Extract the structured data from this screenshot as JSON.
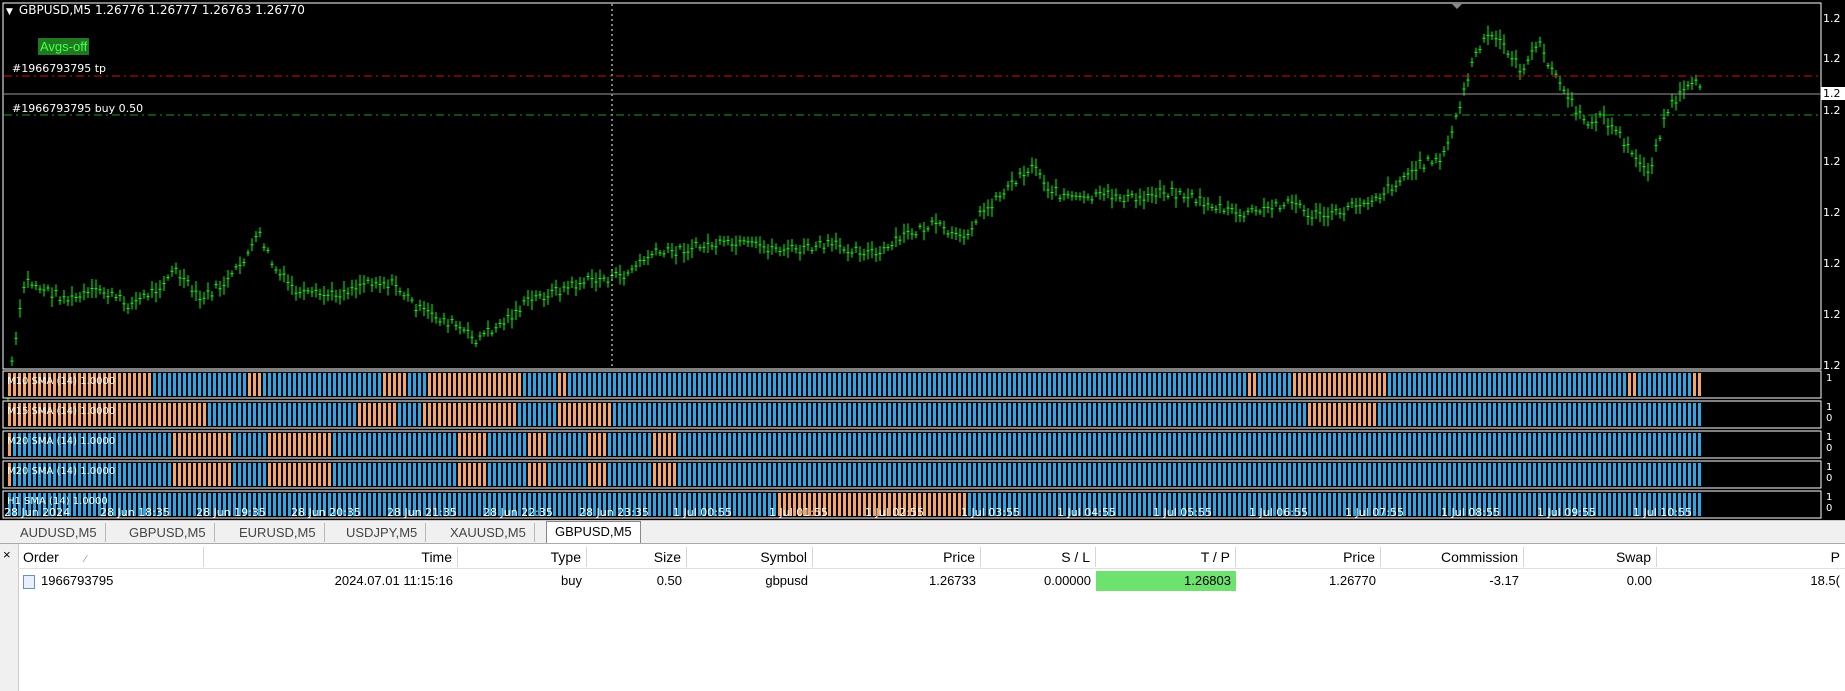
{
  "chart": {
    "symbol_header": "GBPUSD,M5  1.26776 1.26777 1.26763 1.26770",
    "avgs_button": "Avgs-off",
    "tp_label": "#1966793795 tp",
    "buy_label": "#1966793795 buy 0.50",
    "right_price_labels": [
      "1.2",
      "1.2",
      "1.2",
      "1.2",
      "1.2",
      "1.2",
      "1.2",
      "1.2",
      "1.2",
      "1.2",
      "1.2",
      "1.2"
    ],
    "current_price_label": "1.2",
    "colors": {
      "background": "#000000",
      "candle": "#00ff00",
      "tp_line": "#ff0000",
      "buy_line": "#00a000",
      "ind_up": "#2aa7e6",
      "ind_down": "#f5a462"
    },
    "time_ticks": [
      "28 Jun 2024",
      "28 Jun 18:35",
      "28 Jun 19:35",
      "28 Jun 20:35",
      "28 Jun 21:35",
      "28 Jun 22:35",
      "28 Jun 23:35",
      "1 Jul 00:55",
      "1 Jul 01:55",
      "1 Jul 02:55",
      "1 Jul 03:55",
      "1 Jul 04:55",
      "1 Jul 05:55",
      "1 Jul 06:55",
      "1 Jul 07:55",
      "1 Jul 08:55",
      "1 Jul 09:55",
      "1 Jul 10:55"
    ]
  },
  "indicators": [
    {
      "label": "M10 SMA (14) 1.0000",
      "max": "1",
      "min": ""
    },
    {
      "label": "M15 SMA (14) 1.0000",
      "max": "1",
      "min": "0"
    },
    {
      "label": "M20 SMA (14) 1.0000",
      "max": "1",
      "min": "0"
    },
    {
      "label": "M20 SMA (14) 1.0000",
      "max": "1",
      "min": "0"
    },
    {
      "label": "H1 SMA (14) 1.0000",
      "max": "1",
      "min": "0"
    }
  ],
  "tabs": [
    "AUDUSD,M5",
    "GBPUSD,M5",
    "EURUSD,M5",
    "USDJPY,M5",
    "XAUUSD,M5",
    "GBPUSD,M5"
  ],
  "terminal": {
    "close": "×",
    "sort_icon": "⁄",
    "columns": [
      "Order",
      "Time",
      "Type",
      "Size",
      "Symbol",
      "Price",
      "S / L",
      "T / P",
      "Price",
      "Commission",
      "Swap",
      "P"
    ],
    "row": [
      "1966793795",
      "2024.07.01 11:15:16",
      "buy",
      "0.50",
      "gbpusd",
      "1.26733",
      "0.00000",
      "1.26803",
      "1.26770",
      "-3.17",
      "0.00",
      "18.5("
    ]
  }
}
